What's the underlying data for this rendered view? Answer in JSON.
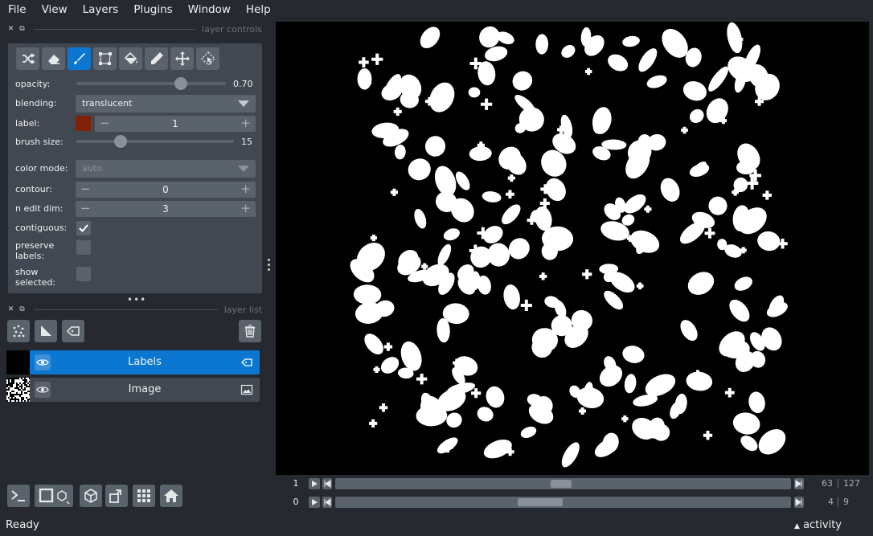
{
  "menubar": {
    "items": [
      "File",
      "View",
      "Layers",
      "Plugins",
      "Window",
      "Help"
    ]
  },
  "layer_controls": {
    "header_title": "layer controls",
    "tools": [
      "shuffle-colors",
      "eraser",
      "paint-brush",
      "polygon",
      "fill-bucket",
      "color-picker",
      "pan-zoom",
      "transform"
    ],
    "active_tool": "paint-brush",
    "opacity": {
      "label": "opacity:",
      "value": "0.70",
      "fraction": 0.7
    },
    "blending": {
      "label": "blending:",
      "value": "translucent"
    },
    "label": {
      "label": "label:",
      "value": "1",
      "color": "#7f2208"
    },
    "brush_size": {
      "label": "brush size:",
      "value": "15",
      "fraction": 0.28
    },
    "color_mode": {
      "label": "color mode:",
      "value": "auto"
    },
    "contour": {
      "label": "contour:",
      "value": "0"
    },
    "n_edit_dim": {
      "label": "n edit dim:",
      "value": "3"
    },
    "contiguous": {
      "label": "contiguous:",
      "checked": true
    },
    "preserve_labels": {
      "label": "preserve\nlabels:",
      "checked": false
    },
    "show_selected": {
      "label": "show\nselected:",
      "checked": false
    }
  },
  "layer_list": {
    "header_title": "layer list",
    "layers": [
      {
        "name": "Labels",
        "selected": true,
        "type_icon": "label-tag-icon"
      },
      {
        "name": "Image",
        "selected": false,
        "type_icon": "image-icon"
      }
    ]
  },
  "dims": [
    {
      "index": "1",
      "current": "63",
      "total": "127",
      "fraction": 0.496
    },
    {
      "index": "0",
      "current": "4",
      "total": "9",
      "fraction": 0.444
    }
  ],
  "status": {
    "text": "Ready",
    "activity_label": "activity"
  },
  "colors": {
    "accent": "#0b77d1",
    "background": "#262930",
    "panel": "#414851",
    "control": "#5a626c"
  }
}
